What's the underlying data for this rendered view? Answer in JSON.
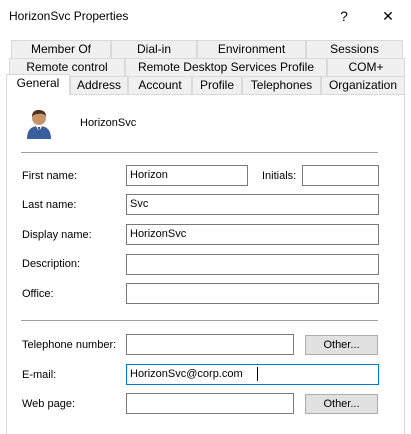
{
  "window": {
    "title": "HorizonSvc Properties",
    "help_glyph": "?",
    "close_glyph": "✕"
  },
  "tabs": {
    "row1": [
      "Member Of",
      "Dial-in",
      "Environment",
      "Sessions"
    ],
    "row2": [
      "Remote control",
      "Remote Desktop Services Profile",
      "COM+"
    ],
    "row3": [
      "General",
      "Address",
      "Account",
      "Profile",
      "Telephones",
      "Organization"
    ],
    "active": "General"
  },
  "general": {
    "object_name": "HorizonSvc",
    "first_name_label": "First name:",
    "first_name_value": "Horizon",
    "initials_label": "Initials:",
    "initials_value": "",
    "last_name_label": "Last name:",
    "last_name_value": "Svc",
    "display_name_label": "Display name:",
    "display_name_value": "HorizonSvc",
    "description_label": "Description:",
    "description_value": "",
    "office_label": "Office:",
    "office_value": "",
    "telephone_label": "Telephone number:",
    "telephone_value": "",
    "telephone_other": "Other...",
    "email_label": "E-mail:",
    "email_value": "HorizonSvc@corp.com",
    "webpage_label": "Web page:",
    "webpage_value": "",
    "webpage_other": "Other..."
  },
  "icons": {
    "user": "user-icon"
  }
}
